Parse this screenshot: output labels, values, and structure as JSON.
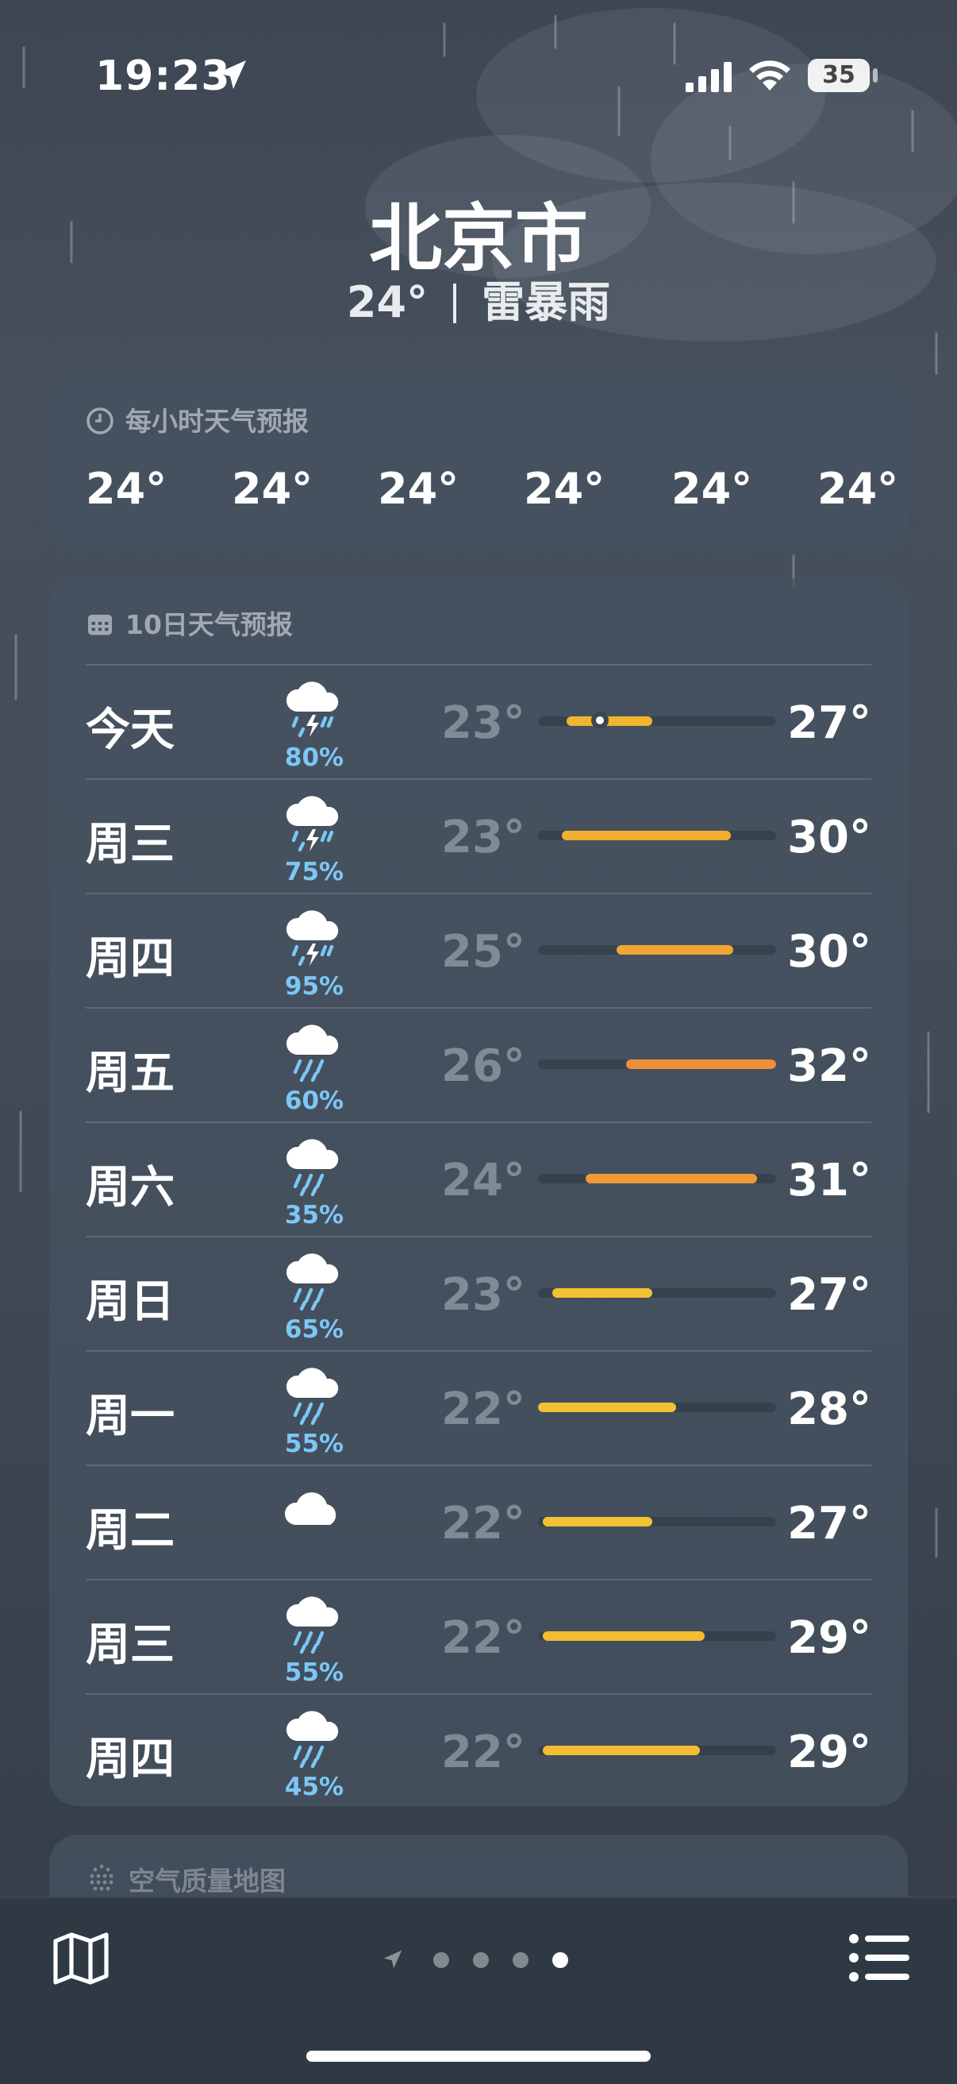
{
  "status_bar": {
    "time": "19:23",
    "battery": "35"
  },
  "location": {
    "city": "北京市",
    "current_temp": "24°",
    "condition": "雷暴雨"
  },
  "hourly": {
    "title": "每小时天气预报",
    "temps": [
      "24°",
      "24°",
      "24°",
      "24°",
      "24°",
      "24°"
    ]
  },
  "daily": {
    "title": "10日天气预报",
    "rows": [
      {
        "day": "今天",
        "icon": "thunderstorm-icon",
        "precip": "80%",
        "low": "23°",
        "high": "27°",
        "range_start_pct": 12,
        "range_end_pct": 48,
        "current_pct": 26,
        "color": "#f0b52d"
      },
      {
        "day": "周三",
        "icon": "thunderstorm-icon",
        "precip": "75%",
        "low": "23°",
        "high": "30°",
        "range_start_pct": 10,
        "range_end_pct": 81,
        "color": "#f0b02e"
      },
      {
        "day": "周四",
        "icon": "thunderstorm-icon",
        "precip": "95%",
        "low": "25°",
        "high": "30°",
        "range_start_pct": 33,
        "range_end_pct": 82,
        "color": "#f0a635"
      },
      {
        "day": "周五",
        "icon": "rain-icon",
        "precip": "60%",
        "low": "26°",
        "high": "32°",
        "range_start_pct": 37,
        "range_end_pct": 100,
        "color": "#ee8f3a"
      },
      {
        "day": "周六",
        "icon": "rain-icon",
        "precip": "35%",
        "low": "24°",
        "high": "31°",
        "range_start_pct": 20,
        "range_end_pct": 92,
        "color": "#f09a38"
      },
      {
        "day": "周日",
        "icon": "rain-icon",
        "precip": "65%",
        "low": "23°",
        "high": "27°",
        "range_start_pct": 6,
        "range_end_pct": 48,
        "color": "#f2c130"
      },
      {
        "day": "周一",
        "icon": "rain-icon",
        "precip": "55%",
        "low": "22°",
        "high": "28°",
        "range_start_pct": 0,
        "range_end_pct": 58,
        "color": "#f2c233"
      },
      {
        "day": "周二",
        "icon": "cloud-icon",
        "precip": "",
        "low": "22°",
        "high": "27°",
        "range_start_pct": 2,
        "range_end_pct": 48,
        "color": "#f2c233"
      },
      {
        "day": "周三",
        "icon": "rain-icon",
        "precip": "55%",
        "low": "22°",
        "high": "29°",
        "range_start_pct": 2,
        "range_end_pct": 70,
        "color": "#f2bd32"
      },
      {
        "day": "周四",
        "icon": "rain-icon",
        "precip": "45%",
        "low": "22°",
        "high": "29°",
        "range_start_pct": 2,
        "range_end_pct": 68,
        "color": "#f2bd32"
      }
    ]
  },
  "air_quality": {
    "title": "空气质量地图"
  },
  "bottom_bar": {
    "pages": 4,
    "active_page": 3
  }
}
